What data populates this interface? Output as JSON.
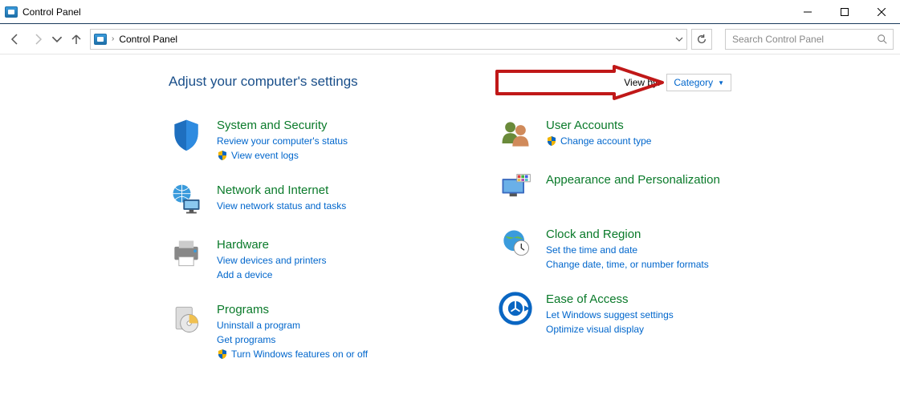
{
  "window": {
    "title": "Control Panel"
  },
  "breadcrumb": {
    "root": "Control Panel"
  },
  "search": {
    "placeholder": "Search Control Panel"
  },
  "heading": "Adjust your computer's settings",
  "viewby": {
    "label": "View by:",
    "value": "Category"
  },
  "left": {
    "system": {
      "title": "System and Security",
      "link1": "Review your computer's status",
      "link2": "View event logs"
    },
    "network": {
      "title": "Network and Internet",
      "link1": "View network status and tasks"
    },
    "hardware": {
      "title": "Hardware",
      "link1": "View devices and printers",
      "link2": "Add a device"
    },
    "programs": {
      "title": "Programs",
      "link1": "Uninstall a program",
      "link2": "Get programs",
      "link3": "Turn Windows features on or off"
    }
  },
  "right": {
    "users": {
      "title": "User Accounts",
      "link1": "Change account type"
    },
    "appearance": {
      "title": "Appearance and Personalization"
    },
    "clock": {
      "title": "Clock and Region",
      "link1": "Set the time and date",
      "link2": "Change date, time, or number formats"
    },
    "ease": {
      "title": "Ease of Access",
      "link1": "Let Windows suggest settings",
      "link2": "Optimize visual display"
    }
  }
}
